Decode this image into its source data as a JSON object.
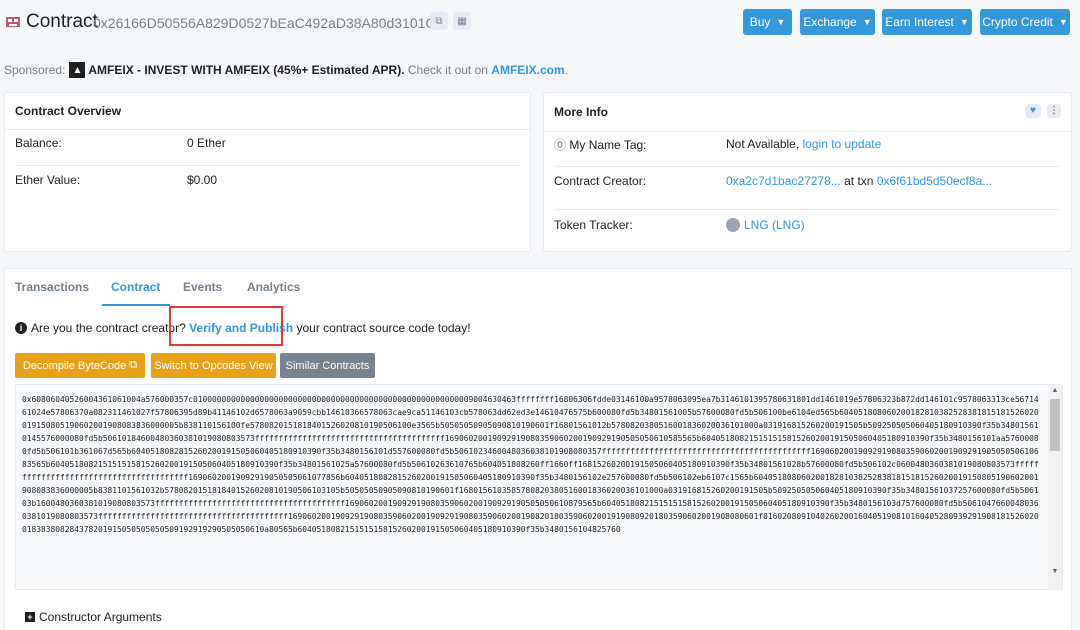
{
  "header": {
    "title": "Contract",
    "address": "0x26166D50556A829D0527bEaC492aD38A80d3101C",
    "buttons": [
      {
        "label": "Buy"
      },
      {
        "label": "Exchange"
      },
      {
        "label": "Earn Interest"
      },
      {
        "label": "Crypto Credit"
      }
    ]
  },
  "sponsor": {
    "prefix": "Sponsored:",
    "name": "AMFEIX - INVEST WITH AMFEIX (45%+ Estimated APR).",
    "middle": "Check it out on",
    "link": "AMFEIX.com",
    "suffix": "."
  },
  "overview": {
    "title": "Contract Overview",
    "balance_label": "Balance:",
    "balance_value": "0 Ether",
    "ether_value_label": "Ether Value:",
    "ether_value_value": "$0.00"
  },
  "moreinfo": {
    "title": "More Info",
    "name_tag_label": "My Name Tag:",
    "name_tag_value": "Not Available,",
    "name_tag_link": "login to update",
    "creator_label": "Contract Creator:",
    "creator_addr": "0xa2c7d1bac27278...",
    "creator_at": "at txn",
    "creator_txn": "0x6f61bd5d50ecf8a...",
    "token_label": "Token Tracker:",
    "token_value": "LNG (LNG)"
  },
  "tabs": {
    "transactions": "Transactions",
    "contract": "Contract",
    "events": "Events",
    "analytics": "Analytics"
  },
  "notice": {
    "pre": "Are you the contract creator?",
    "link": "Verify and Publish",
    "post": "your contract source code today!"
  },
  "actions": {
    "decompile": "Decompile ByteCode",
    "opcodes": "Switch to Opcodes View",
    "similar": "Similar Contracts"
  },
  "bytecode": "0x60806040526004361061004a576000357c01000000000000000000000000000000000000000000000000000000009004630463ffffffff16806306fdde03146100a9578063095ea7b3146101395780631801dd1461019e57806323b872dd146101c9578063313ce5671461024e57806370a082311461027f57806395d89b41146102d6578063a9059cbb14610366578063cae9ca51146103cb578063dd62ed3e14610476575b600080fd5b34801561005b57600080fd5b506100be6104ed565b604051808060200182810382528381815181526020019150805190602001908083836000005b838110156100fe5780820151818401526020810190506100e3565b50505050905090810190601f16801561012b5780820380516001836020036101000a031916815260200191505b509250505060405180910390f35b348015610145576000080fd5b50610184600480360381019080803573ffffffffffffffffffffffffffffffffffffffff16906020019092919080359060200190929190505050610585565b604051808215151515815260200191505060405180910390f35b3480156101aa57600080fd5b506101b361067d565b6040518082815260200191505060405180910390f35b3480156101d557600080fd5b5061023460048036038101908080357ffffffffffffffffffffffffffffffffffffffffffff16906020019092919080359060200190929190505050610683565b604051808215151515815260200191505060405180910390f35b34801561025a57600080fd5b50610263610765b604051808260ff1660ff16815260200191505060405180910390f35b34801561028b57600080fd5b506102c0600480360381019080803573ffffffffffffffffffffffffffffffffffffffff16906020019092919050505061077856b6040518082815260200191505060405180910390f35b3480156102e257600080fd5b506102eb6107c1565b604051808060200182810382528381815181526020019150805190602001908083836000005b8381101561032b5780820151818401526020810190506103105b50505050905090810190601f1680156103585780820380516001836020036101000a031916815260200191505b509250505060405180910390f35b34801561037257600080fd5b506103b1600480360381019080803573ffffffffffffffffffffffffffffffffffffffff16906020019092919080359060200190929190505050610879565b604051808215151515815260200191505060405180910390f35b3480156103d757600080fd5b50610476600480360381019080803573ffffffffffffffffffffffffffffffffffffffff169060200190929190803590602001909291908035906020019082018035906020019190809201803590602001908080601f0160208091040260200160405190810160405280939291908181526020018383808284378201915050505050509192919290505050610a80565b604051808215151515815260200191505060405180910390f35b3480156104825760",
  "constructor": "Constructor Arguments",
  "colors": {
    "accent": "#3498db",
    "decompile": "#e7a21a",
    "opcodes": "#e7a21a",
    "similar": "#77838f",
    "highlight_box": "#e53935"
  }
}
